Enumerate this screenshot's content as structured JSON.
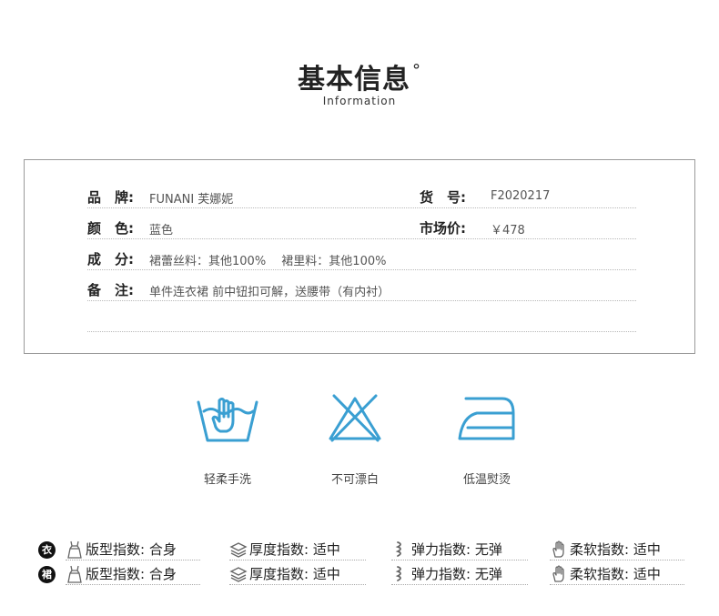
{
  "header": {
    "title": "基本信息",
    "subtitle": "Information"
  },
  "info": {
    "brand_label": "品　牌:",
    "brand_value": "FUNANI 芙娜妮",
    "sku_label": "货　号:",
    "sku_value": "F2020217",
    "color_label": "颜　色:",
    "color_value": "蓝色",
    "price_label": "市场价:",
    "price_value": "￥478",
    "material_label": "成　分:",
    "material_value": "裙蕾丝料：其他100%　 裙里料：其他100%",
    "note_label": "备　注:",
    "note_value": "单件连衣裙 前中钮扣可解，送腰带（有内衬）"
  },
  "care": [
    {
      "label": "轻柔手洗",
      "icon": "hand-wash-icon"
    },
    {
      "label": "不可漂白",
      "icon": "no-bleach-icon"
    },
    {
      "label": "低温熨烫",
      "icon": "low-iron-icon"
    }
  ],
  "indices": {
    "rows": [
      {
        "badge": "衣",
        "fit": "版型指数:  合身",
        "thickness": "厚度指数:  适中",
        "elastic": "弹力指数:  无弹",
        "softness": "柔软指数:  适中"
      },
      {
        "badge": "裙",
        "fit": "版型指数:  合身",
        "thickness": "厚度指数:  适中",
        "elastic": "弹力指数:  无弹",
        "softness": "柔软指数:  适中"
      }
    ]
  },
  "colors": {
    "icon_blue": "#3a9fd2",
    "text_dark": "#222222",
    "text_muted": "#555555",
    "border": "#9a9a9a"
  }
}
